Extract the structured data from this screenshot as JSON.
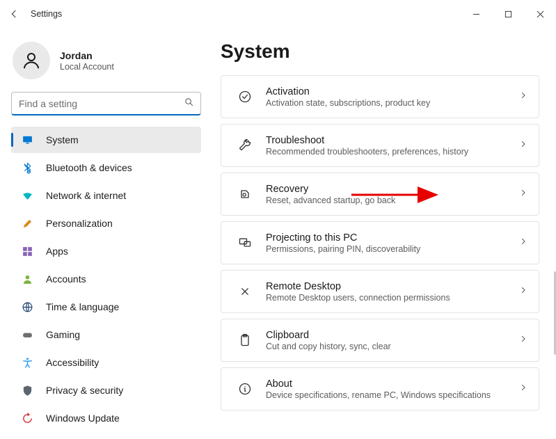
{
  "window": {
    "title": "Settings"
  },
  "profile": {
    "name": "Jordan",
    "subtitle": "Local Account"
  },
  "search": {
    "placeholder": "Find a setting",
    "value": ""
  },
  "sidebar": {
    "items": [
      {
        "id": "system",
        "label": "System",
        "icon": "monitor-icon",
        "color": "ic-blue",
        "active": true
      },
      {
        "id": "bluetooth",
        "label": "Bluetooth & devices",
        "icon": "bluetooth-icon",
        "color": "ic-blue"
      },
      {
        "id": "network",
        "label": "Network & internet",
        "icon": "wifi-icon",
        "color": "ic-teal"
      },
      {
        "id": "personalization",
        "label": "Personalization",
        "icon": "paintbrush-icon",
        "color": "ic-orange"
      },
      {
        "id": "apps",
        "label": "Apps",
        "icon": "apps-icon",
        "color": "ic-purple"
      },
      {
        "id": "accounts",
        "label": "Accounts",
        "icon": "person-icon",
        "color": "ic-green"
      },
      {
        "id": "time",
        "label": "Time & language",
        "icon": "globe-icon",
        "color": "ic-navy"
      },
      {
        "id": "gaming",
        "label": "Gaming",
        "icon": "gamepad-icon",
        "color": "ic-grey"
      },
      {
        "id": "accessibility",
        "label": "Accessibility",
        "icon": "accessibility-icon",
        "color": "ic-sky"
      },
      {
        "id": "privacy",
        "label": "Privacy & security",
        "icon": "shield-icon",
        "color": "ic-slate"
      },
      {
        "id": "update",
        "label": "Windows Update",
        "icon": "update-icon",
        "color": "ic-red"
      }
    ]
  },
  "main": {
    "title": "System",
    "cards": [
      {
        "id": "activation",
        "title": "Activation",
        "sub": "Activation state, subscriptions, product key",
        "icon": "check-circle-icon"
      },
      {
        "id": "troubleshoot",
        "title": "Troubleshoot",
        "sub": "Recommended troubleshooters, preferences, history",
        "icon": "wrench-icon"
      },
      {
        "id": "recovery",
        "title": "Recovery",
        "sub": "Reset, advanced startup, go back",
        "icon": "recovery-icon"
      },
      {
        "id": "projecting",
        "title": "Projecting to this PC",
        "sub": "Permissions, pairing PIN, discoverability",
        "icon": "projection-icon"
      },
      {
        "id": "remote-desktop",
        "title": "Remote Desktop",
        "sub": "Remote Desktop users, connection permissions",
        "icon": "remote-icon"
      },
      {
        "id": "clipboard",
        "title": "Clipboard",
        "sub": "Cut and copy history, sync, clear",
        "icon": "clipboard-icon"
      },
      {
        "id": "about",
        "title": "About",
        "sub": "Device specifications, rename PC, Windows specifications",
        "icon": "info-icon"
      }
    ]
  },
  "annotation": {
    "type": "arrow",
    "color": "#e60000",
    "points_to": "recovery"
  }
}
